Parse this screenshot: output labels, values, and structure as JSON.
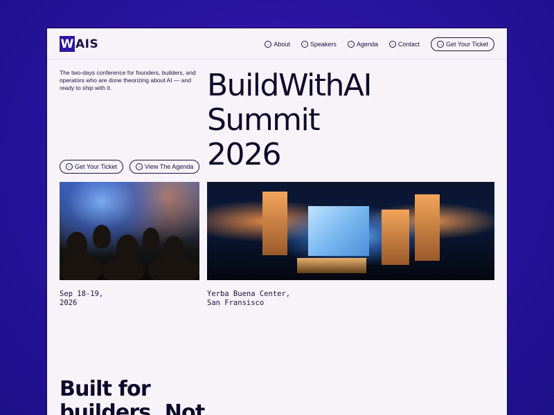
{
  "header": {
    "logo_mark": "W",
    "logo_rest": "AIS",
    "nav": [
      {
        "label": "About"
      },
      {
        "label": "Speakers"
      },
      {
        "label": "Agenda"
      },
      {
        "label": "Contact"
      }
    ],
    "cta_label": "Get Your Ticket",
    "arrow_glyph": "→"
  },
  "hero": {
    "tagline": "The two-days conference for founders, builders, and operators who are done theorizing about AI — and ready to ship with it.",
    "title_lines": [
      "BuildWithAI",
      "Summit",
      "2026"
    ],
    "buttons": [
      {
        "label": "Get Your Ticket"
      },
      {
        "label": "View The Agenda"
      }
    ]
  },
  "images": {
    "left_alt": "audience-photo",
    "right_alt": "stage-photo"
  },
  "captions": {
    "date": [
      "Sep 18-19,",
      "2026"
    ],
    "venue": [
      "Yerba Buena Center,",
      "San Fransisco"
    ]
  },
  "section": {
    "title_lines": [
      "Built for",
      "builders. Not"
    ]
  },
  "colors": {
    "background": "#2a14a0",
    "page": "#f7f3f8",
    "brand": "#2b17a0",
    "text": "#0e0a2a"
  }
}
